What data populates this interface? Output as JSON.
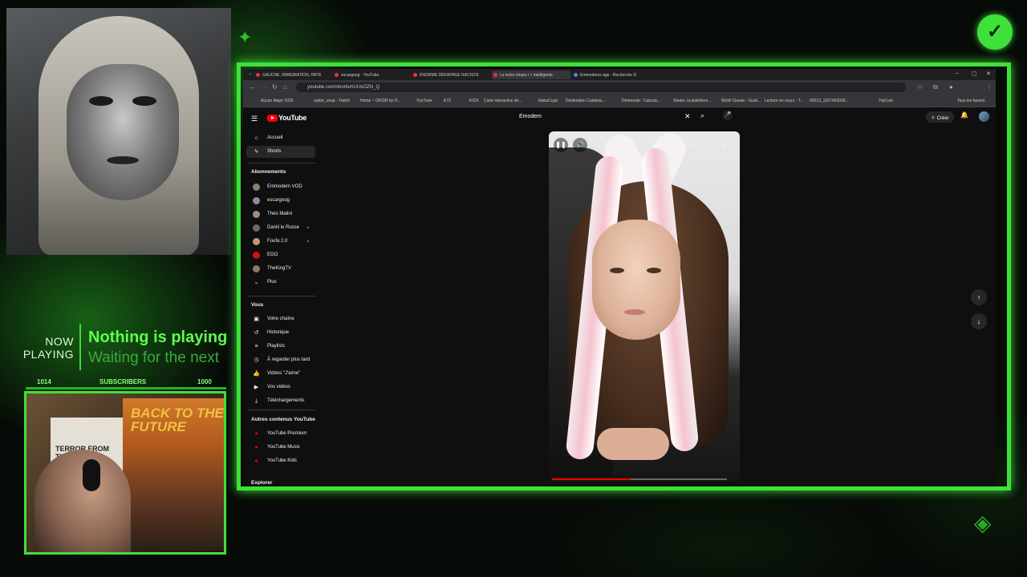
{
  "overlay": {
    "now_playing_label": "NOW PLAYING",
    "now_playing_title": "Nothing is playing",
    "now_playing_sub": "Waiting for the next",
    "subs_left": "1014",
    "subs_label": "SUBSCRIBERS",
    "subs_right": "1000",
    "poster_title": "BACK TO THE FUTURE",
    "poster2_text": "TERROR FROM THE"
  },
  "browser": {
    "tabs": [
      {
        "label": "GAUCHE, IMMIGRATION, PATR"
      },
      {
        "label": "escargoog - YouTube"
      },
      {
        "label": "ÉNORME DÉRAPAGE RACISTE"
      },
      {
        "label": "Le turbo-shapo i + intelligente"
      },
      {
        "label": "Emmodemz age - Recherche G"
      }
    ],
    "url": "youtube.com/shorts/nUUsOZhl_Q",
    "bookmarks": [
      "Aucun Major 2025",
      "reptor_voop - Twitch",
      "Home ~ OFIDR by O...",
      "YouTube",
      "E72",
      "KICK",
      "Carte interactive de...",
      "NubaCrypt",
      "Destination Calabria...",
      "Démonste : Calcula...",
      "Steam, la plateform...",
      "WoW Classic - Guid...",
      "Lecture en cours - T...",
      "60013_1557453028...",
      "YtpCom",
      "Tous les favoris"
    ]
  },
  "youtube": {
    "logo_text": "YouTube",
    "search_value": "Emodem",
    "create_label": "Créer",
    "sidebar": {
      "main": [
        {
          "label": "Accueil",
          "icon": "home-icon"
        },
        {
          "label": "Shorts",
          "icon": "shorts-icon"
        }
      ],
      "subs_header": "Abonnements",
      "subs": [
        {
          "label": "Emmodem VOD",
          "color": "#7a8a6a",
          "dot": false
        },
        {
          "label": "escargoog",
          "color": "#8a8aa0",
          "dot": false
        },
        {
          "label": "Théo Malini",
          "color": "#a08a7a",
          "dot": false
        },
        {
          "label": "Daniil le Russe",
          "color": "#6a6a6a",
          "dot": true
        },
        {
          "label": "Foufa 2.0",
          "color": "#c09a60",
          "dot": true
        },
        {
          "label": "EGO",
          "color": "#d01010",
          "dot": false
        },
        {
          "label": "TheKingTV",
          "color": "#8a7a6a",
          "dot": false
        }
      ],
      "more_label": "Plus",
      "you_header": "Vous",
      "you": [
        {
          "label": "Votre chaîne",
          "icon": "channel-icon",
          "glyph": "▣"
        },
        {
          "label": "Historique",
          "icon": "history-icon",
          "glyph": "↺"
        },
        {
          "label": "Playlists",
          "icon": "playlists-icon",
          "glyph": "≡"
        },
        {
          "label": "À regarder plus tard",
          "icon": "watch-later-icon",
          "glyph": "◷"
        },
        {
          "label": "Vidéos \"J'aime\"",
          "icon": "like-icon",
          "glyph": "👍"
        },
        {
          "label": "Vos vidéos",
          "icon": "your-videos-icon",
          "glyph": "▶"
        },
        {
          "label": "Téléchargements",
          "icon": "download-icon",
          "glyph": "⤓"
        }
      ],
      "other_header": "Autres contenus YouTube",
      "other": [
        {
          "label": "YouTube Premium"
        },
        {
          "label": "YouTube Music"
        },
        {
          "label": "YouTube Kids"
        }
      ],
      "explore_header": "Explorer"
    },
    "video_progress": 0.45
  }
}
